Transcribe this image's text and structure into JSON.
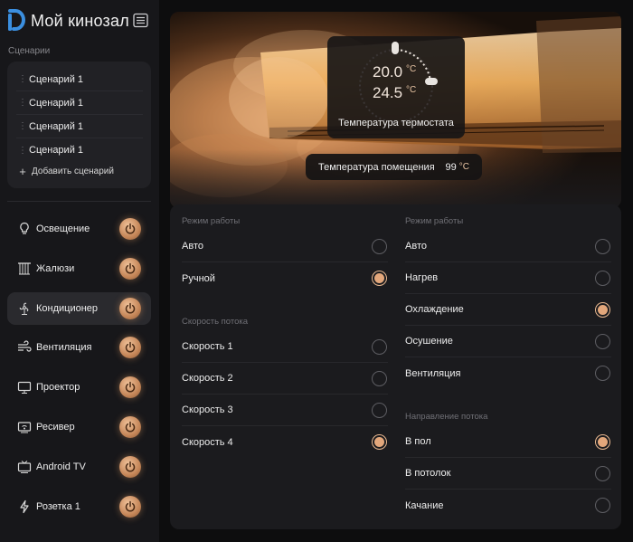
{
  "app": {
    "title": "Мой кинозал"
  },
  "scenarios": {
    "title": "Сценарии",
    "items": [
      "Сценарий 1",
      "Сценарий 1",
      "Сценарий 1",
      "Сценарий 1"
    ],
    "add_label": "Добавить сценарий"
  },
  "devices": [
    {
      "label": "Освещение",
      "icon": "lightbulb-icon",
      "active": false
    },
    {
      "label": "Жалюзи",
      "icon": "blinds-icon",
      "active": false
    },
    {
      "label": "Кондиционер",
      "icon": "fan-icon",
      "active": true
    },
    {
      "label": "Вентиляция",
      "icon": "wind-icon",
      "active": false
    },
    {
      "label": "Проектор",
      "icon": "projector-icon",
      "active": false
    },
    {
      "label": "Ресивер",
      "icon": "receiver-icon",
      "active": false
    },
    {
      "label": "Android TV",
      "icon": "tv-icon",
      "active": false
    },
    {
      "label": "Розетка 1",
      "icon": "socket-icon",
      "active": false
    }
  ],
  "thermostat": {
    "set_temp": "20.0",
    "current_temp": "24.5",
    "unit": "°C",
    "label": "Температура термостата"
  },
  "room": {
    "label": "Температура помещения",
    "value": "99",
    "unit": "°C"
  },
  "left_groups": [
    {
      "title": "Режим работы",
      "options": [
        {
          "label": "Авто",
          "selected": false
        },
        {
          "label": "Ручной",
          "selected": true
        }
      ]
    },
    {
      "title": "Скорость потока",
      "options": [
        {
          "label": "Скорость 1",
          "selected": false
        },
        {
          "label": "Скорость 2",
          "selected": false
        },
        {
          "label": "Скорость 3",
          "selected": false
        },
        {
          "label": "Скорость 4",
          "selected": true
        }
      ]
    }
  ],
  "right_groups": [
    {
      "title": "Режим работы",
      "options": [
        {
          "label": "Авто",
          "selected": false
        },
        {
          "label": "Нагрев",
          "selected": false
        },
        {
          "label": "Охлаждение",
          "selected": true
        },
        {
          "label": "Осушение",
          "selected": false
        },
        {
          "label": "Вентиляция",
          "selected": false
        }
      ]
    },
    {
      "title": "Направление потока",
      "options": [
        {
          "label": "В пол",
          "selected": true
        },
        {
          "label": "В потолок",
          "selected": false
        },
        {
          "label": "Качание",
          "selected": false
        }
      ]
    }
  ],
  "colors": {
    "accent": "#e3a77b",
    "sidebar": "#17171a",
    "panel": "#1b1b1e"
  }
}
